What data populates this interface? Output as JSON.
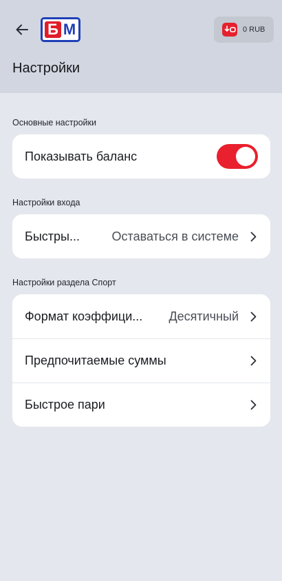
{
  "header": {
    "logo_text_1": "Б",
    "logo_text_2": "М",
    "balance": "0 RUB",
    "title": "Настройки"
  },
  "sections": [
    {
      "label": "Основные настройки",
      "rows": [
        {
          "label": "Показывать баланс",
          "toggle_on": true
        }
      ]
    },
    {
      "label": "Настройки входа",
      "rows": [
        {
          "label": "Быстры...",
          "value": "Оставаться в системе"
        }
      ]
    },
    {
      "label": "Настройки раздела Спорт",
      "rows": [
        {
          "label": "Формат коэффици...",
          "value": "Десятичный"
        },
        {
          "label": "Предпочитаемые суммы"
        },
        {
          "label": "Быстрое пари"
        }
      ]
    }
  ],
  "colors": {
    "accent": "#e9202d",
    "header_bg": "#d1d6e0",
    "page_bg": "#e4e7ed",
    "logo_blue": "#1f3fb8"
  }
}
